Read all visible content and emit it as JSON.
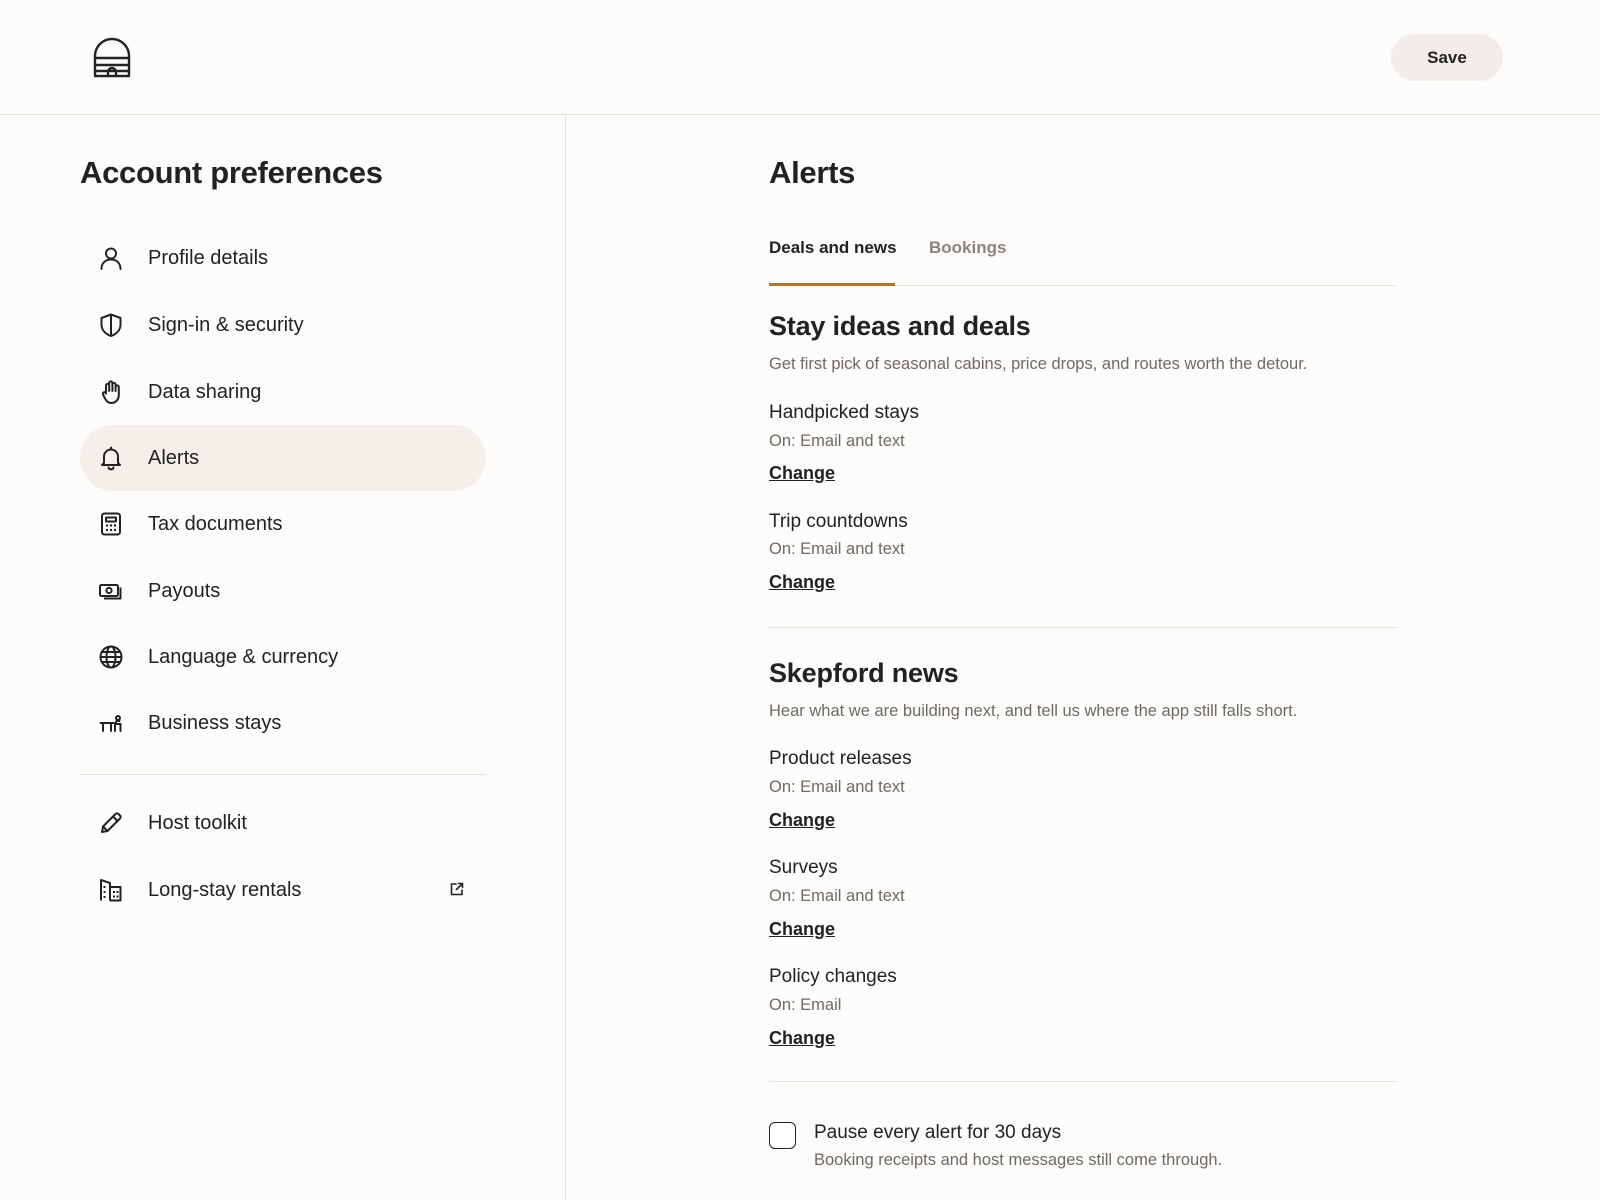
{
  "header": {
    "logo_icon": "cabin-dome-icon",
    "save_label": "Save"
  },
  "sidebar": {
    "title": "Account preferences",
    "items": [
      {
        "label": "Profile details",
        "icon": "person-icon"
      },
      {
        "label": "Sign-in & security",
        "icon": "shield-icon"
      },
      {
        "label": "Data sharing",
        "icon": "hand-icon"
      },
      {
        "label": "Alerts",
        "icon": "bell-icon",
        "active": true
      },
      {
        "label": "Tax documents",
        "icon": "calculator-icon"
      },
      {
        "label": "Payouts",
        "icon": "cash-icon"
      },
      {
        "label": "Language & currency",
        "icon": "globe-icon"
      },
      {
        "label": "Business stays",
        "icon": "desk-icon"
      }
    ],
    "secondary_items": [
      {
        "label": "Host toolkit",
        "icon": "pencil-icon"
      },
      {
        "label": "Long-stay rentals",
        "icon": "building-icon",
        "external": true
      }
    ]
  },
  "main": {
    "title": "Alerts",
    "tabs": [
      {
        "label": "Deals and news",
        "active": true
      },
      {
        "label": "Bookings",
        "active": false
      }
    ],
    "sections": [
      {
        "title": "Stay ideas and deals",
        "description": "Get first pick of seasonal cabins, price drops, and routes worth the detour.",
        "prefs": [
          {
            "label": "Handpicked stays",
            "status": "On: Email and text",
            "action": "Change"
          },
          {
            "label": "Trip countdowns",
            "status": "On: Email and text",
            "action": "Change"
          }
        ]
      },
      {
        "title": "Skepford news",
        "description": "Hear what we are building next, and tell us where the app still falls short.",
        "prefs": [
          {
            "label": "Product releases",
            "status": "On: Email and text",
            "action": "Change"
          },
          {
            "label": "Surveys",
            "status": "On: Email and text",
            "action": "Change"
          },
          {
            "label": "Policy changes",
            "status": "On: Email",
            "action": "Change"
          }
        ]
      }
    ],
    "pause": {
      "label": "Pause every alert for 30 days",
      "description": "Booking receipts and host messages still come through.",
      "checked": false
    }
  },
  "colors": {
    "accent": "#a8792c",
    "active_nav_bg": "#f3f0ea",
    "button_bg": "#f1eee9",
    "border": "#e6e3df",
    "muted_text": "#6e6a65"
  }
}
